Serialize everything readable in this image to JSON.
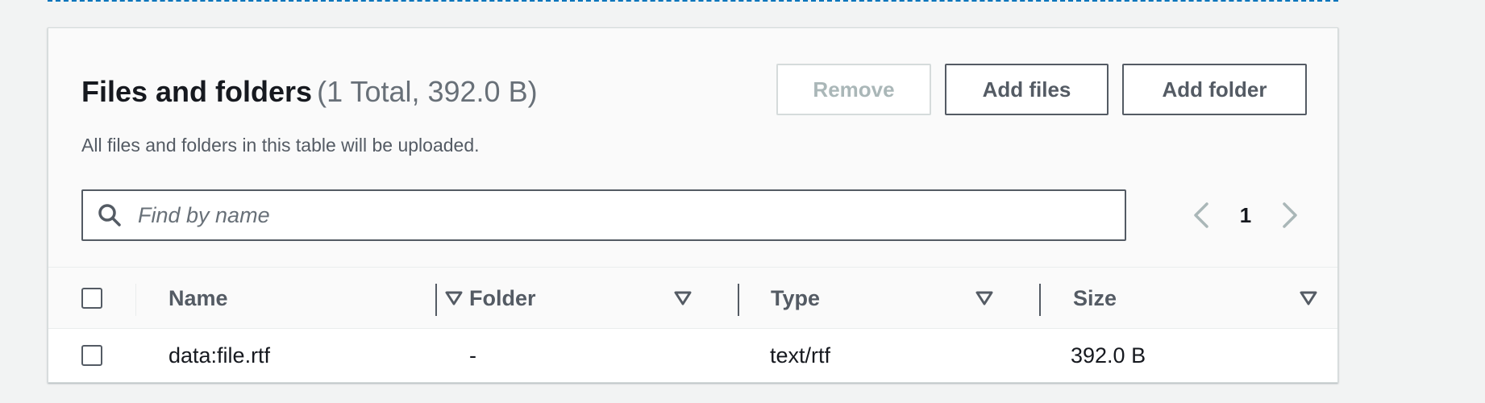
{
  "panel": {
    "title": "Files and folders",
    "counter": "(1 Total, 392.0 B)",
    "description": "All files and folders in this table will be uploaded."
  },
  "actions": {
    "remove_label": "Remove",
    "add_files_label": "Add files",
    "add_folder_label": "Add folder"
  },
  "search": {
    "placeholder": "Find by name",
    "value": ""
  },
  "pagination": {
    "current_page": "1"
  },
  "table": {
    "columns": [
      "Name",
      "Folder",
      "Type",
      "Size"
    ],
    "rows": [
      {
        "name": "data:file.rtf",
        "folder": "-",
        "type": "text/rtf",
        "size": "392.0 B"
      }
    ]
  },
  "icons": {
    "search": "search-icon",
    "prev": "chevron-left-icon",
    "next": "chevron-right-icon",
    "sort": "sort-caret-down-icon"
  },
  "colors": {
    "accent_dashed": "#0073bb",
    "button_border": "#545b64",
    "disabled": "#aab7b8",
    "background": "#f2f3f3"
  }
}
